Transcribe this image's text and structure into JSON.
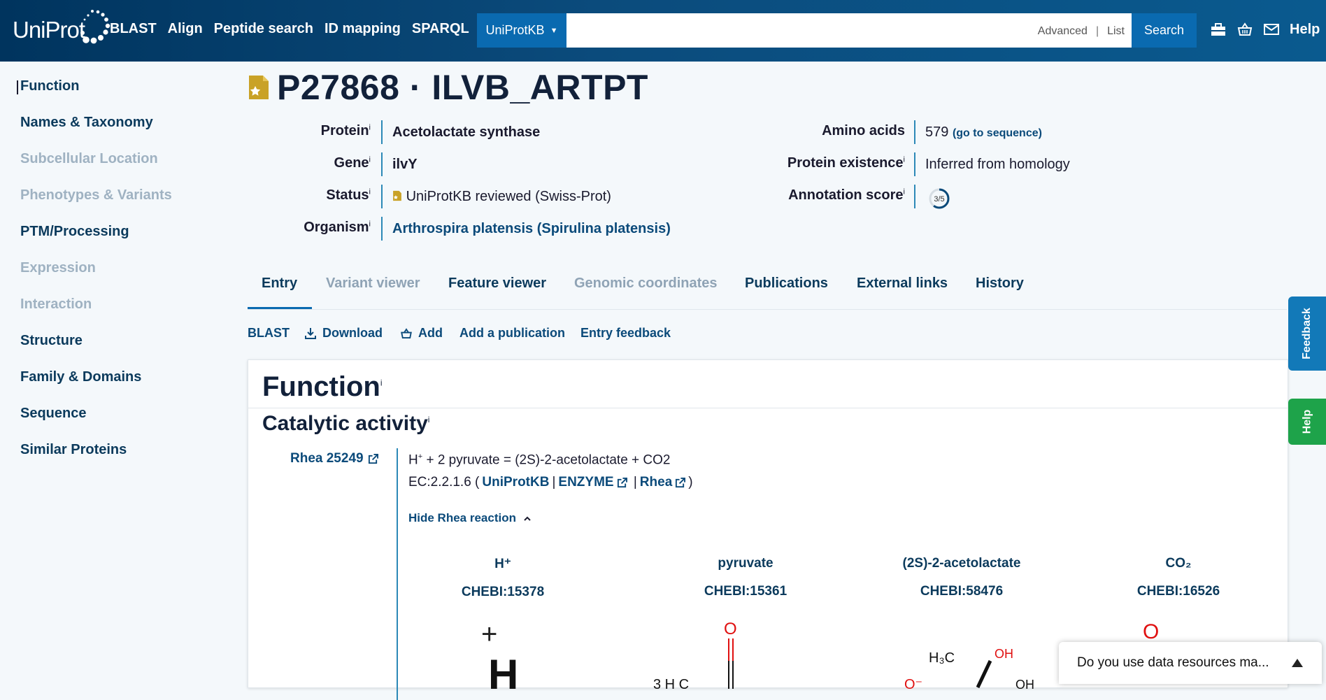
{
  "header": {
    "logo_text": "UniProt",
    "nav": [
      "BLAST",
      "Align",
      "Peptide search",
      "ID mapping",
      "SPARQL"
    ],
    "db_select": "UniProtKB",
    "search_value": "",
    "advanced_label": "Advanced",
    "list_label": "List",
    "search_button": "Search",
    "help_label": "Help",
    "icons": [
      "toolkit-icon",
      "basket-icon",
      "mail-icon"
    ]
  },
  "sidebar": {
    "items": [
      {
        "label": "Function",
        "enabled": true
      },
      {
        "label": "Names & Taxonomy",
        "enabled": true
      },
      {
        "label": "Subcellular Location",
        "enabled": false
      },
      {
        "label": "Phenotypes & Variants",
        "enabled": false
      },
      {
        "label": "PTM/Processing",
        "enabled": true
      },
      {
        "label": "Expression",
        "enabled": false
      },
      {
        "label": "Interaction",
        "enabled": false
      },
      {
        "label": "Structure",
        "enabled": true
      },
      {
        "label": "Family & Domains",
        "enabled": true
      },
      {
        "label": "Sequence",
        "enabled": true
      },
      {
        "label": "Similar Proteins",
        "enabled": true
      }
    ]
  },
  "entry": {
    "title": "P27868 · ILVB_ARTPT",
    "protein_label": "Protein",
    "protein": "Acetolactate synthase",
    "gene_label": "Gene",
    "gene": "ilvY",
    "status_label": "Status",
    "status": "UniProtKB reviewed (Swiss-Prot)",
    "organism_label": "Organism",
    "organism": "Arthrospira platensis (Spirulina platensis)",
    "amino_acids_label": "Amino acids",
    "amino_acids": "579",
    "go_to_sequence": "(go to sequence)",
    "existence_label": "Protein existence",
    "existence": "Inferred from homology",
    "score_label": "Annotation score",
    "score": "3/5",
    "score_fraction": 0.6,
    "info_mark": "i"
  },
  "tabs": [
    "Entry",
    "Variant viewer",
    "Feature viewer",
    "Genomic coordinates",
    "Publications",
    "External links",
    "History"
  ],
  "actions": {
    "blast": "BLAST",
    "download": "Download",
    "add": "Add",
    "add_publication": "Add a publication",
    "entry_feedback": "Entry feedback"
  },
  "function": {
    "title": "Function",
    "catalytic_title": "Catalytic activity",
    "rhea_id": "Rhea 25249",
    "reaction_prefix": "H",
    "reaction_sup": "+",
    "reaction_rest": " + 2 pyruvate = (2S)-2-acetolactate + CO2",
    "ec_prefix": "EC:2.2.1.6 (",
    "ec_uniprotkb": "UniProtKB",
    "ec_enzyme": "ENZYME",
    "ec_rhea": "Rhea",
    "ec_close": ")",
    "hide_rhea": "Hide Rhea reaction",
    "chems": [
      {
        "name": "H⁺",
        "chebi": "CHEBI:15378"
      },
      {
        "name": "pyruvate",
        "chebi": "CHEBI:15361"
      },
      {
        "name": "(2S)-2-acetolactate",
        "chebi": "CHEBI:58476"
      },
      {
        "name": "CO₂",
        "chebi": "CHEBI:16526"
      }
    ],
    "plus": "+"
  },
  "side": {
    "feedback": "Feedback",
    "help": "Help"
  },
  "survey": {
    "text": "Do you use data resources ma..."
  },
  "colors": {
    "header_dark": "#00345e",
    "accent": "#0a6ab0",
    "link": "#0b4a7a",
    "reviewed_gold": "#c9a227",
    "feedback_blue": "#1279b8",
    "help_green": "#1ea34a"
  }
}
